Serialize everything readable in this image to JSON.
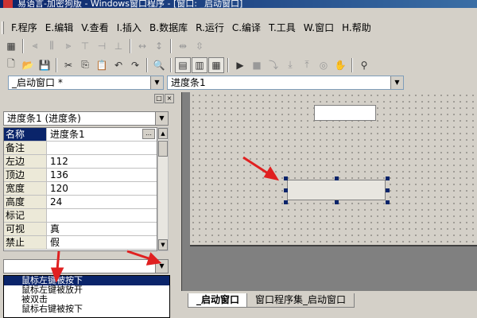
{
  "window": {
    "title": "易语言-加密狗版 - Windows窗口程序 - [窗口: _启动窗口]"
  },
  "menu": [
    "F.程序",
    "E.编辑",
    "V.查看",
    "I.插入",
    "B.数据库",
    "R.运行",
    "C.编译",
    "T.工具",
    "W.窗口",
    "H.帮助"
  ],
  "toolbar_row1": [
    "align-left-icon",
    "align-center-icon",
    "align-right-icon",
    "align-top-icon",
    "align-middle-icon",
    "align-bottom-icon",
    "same-width-icon",
    "same-height-icon",
    "space-horizontal-icon",
    "space-vertical-icon"
  ],
  "toolbar_row2": [
    "new-file-icon",
    "open-folder-icon",
    "save-icon",
    "cut-icon",
    "copy-icon",
    "paste-icon",
    "undo-icon",
    "redo-icon",
    "find-icon",
    "layout1-icon",
    "layout2-icon",
    "layout3-icon",
    "run-icon",
    "stop-icon",
    "step-icon",
    "step-into-icon",
    "step-out-icon",
    "breakpoint-icon",
    "hand-icon",
    "search-binoculars-icon"
  ],
  "window_selector": "_启动窗口 *",
  "control_selector": "进度条1",
  "object_combo": "进度条1 (进度条)",
  "properties": [
    {
      "name": "名称",
      "value": "进度条1",
      "selected": true,
      "has_button": true
    },
    {
      "name": "备注",
      "value": ""
    },
    {
      "name": "左边",
      "value": "112"
    },
    {
      "name": "顶边",
      "value": "136"
    },
    {
      "name": "宽度",
      "value": "120"
    },
    {
      "name": "高度",
      "value": "24"
    },
    {
      "name": "标记",
      "value": ""
    },
    {
      "name": "可视",
      "value": "真"
    },
    {
      "name": "禁止",
      "value": "假"
    }
  ],
  "event_combo": "",
  "event_dropdown": [
    "鼠标左键被按下",
    "鼠标左键被放开",
    "被双击",
    "鼠标右键被按下"
  ],
  "event_dropdown_selected": 0,
  "design_tabs": [
    {
      "label": "_启动窗口",
      "active": true
    },
    {
      "label": "窗口程序集_启动窗口",
      "active": false
    }
  ],
  "colors": {
    "accent": "#0a246a",
    "arrow": "#e02020",
    "panel": "#d4d0c8"
  }
}
